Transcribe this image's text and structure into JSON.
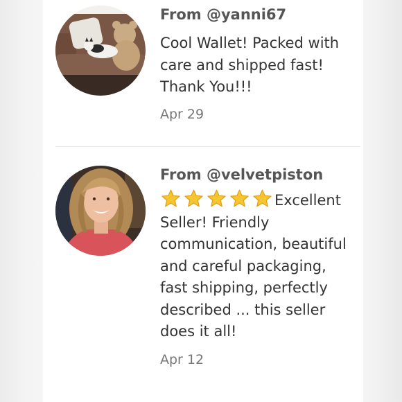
{
  "reviews": [
    {
      "from": "From @yanni67",
      "text": "Cool Wallet! Packed with care and shipped fast! Thank You!!!",
      "date": "Apr 29",
      "rating_stars": 0
    },
    {
      "from": "From @velvetpiston",
      "text": "Excellent Seller! Friendly communication, beautiful and careful packaging, fast shipping, perfectly described ... this seller does it all!",
      "date": "Apr 12",
      "rating_stars": 5
    }
  ],
  "colors": {
    "from_text": "#555555",
    "body_text": "#333333",
    "date_text": "#777777",
    "star_fill": "#f7c531",
    "star_stroke": "#e0a117"
  },
  "icons": {
    "star": "star-icon"
  }
}
